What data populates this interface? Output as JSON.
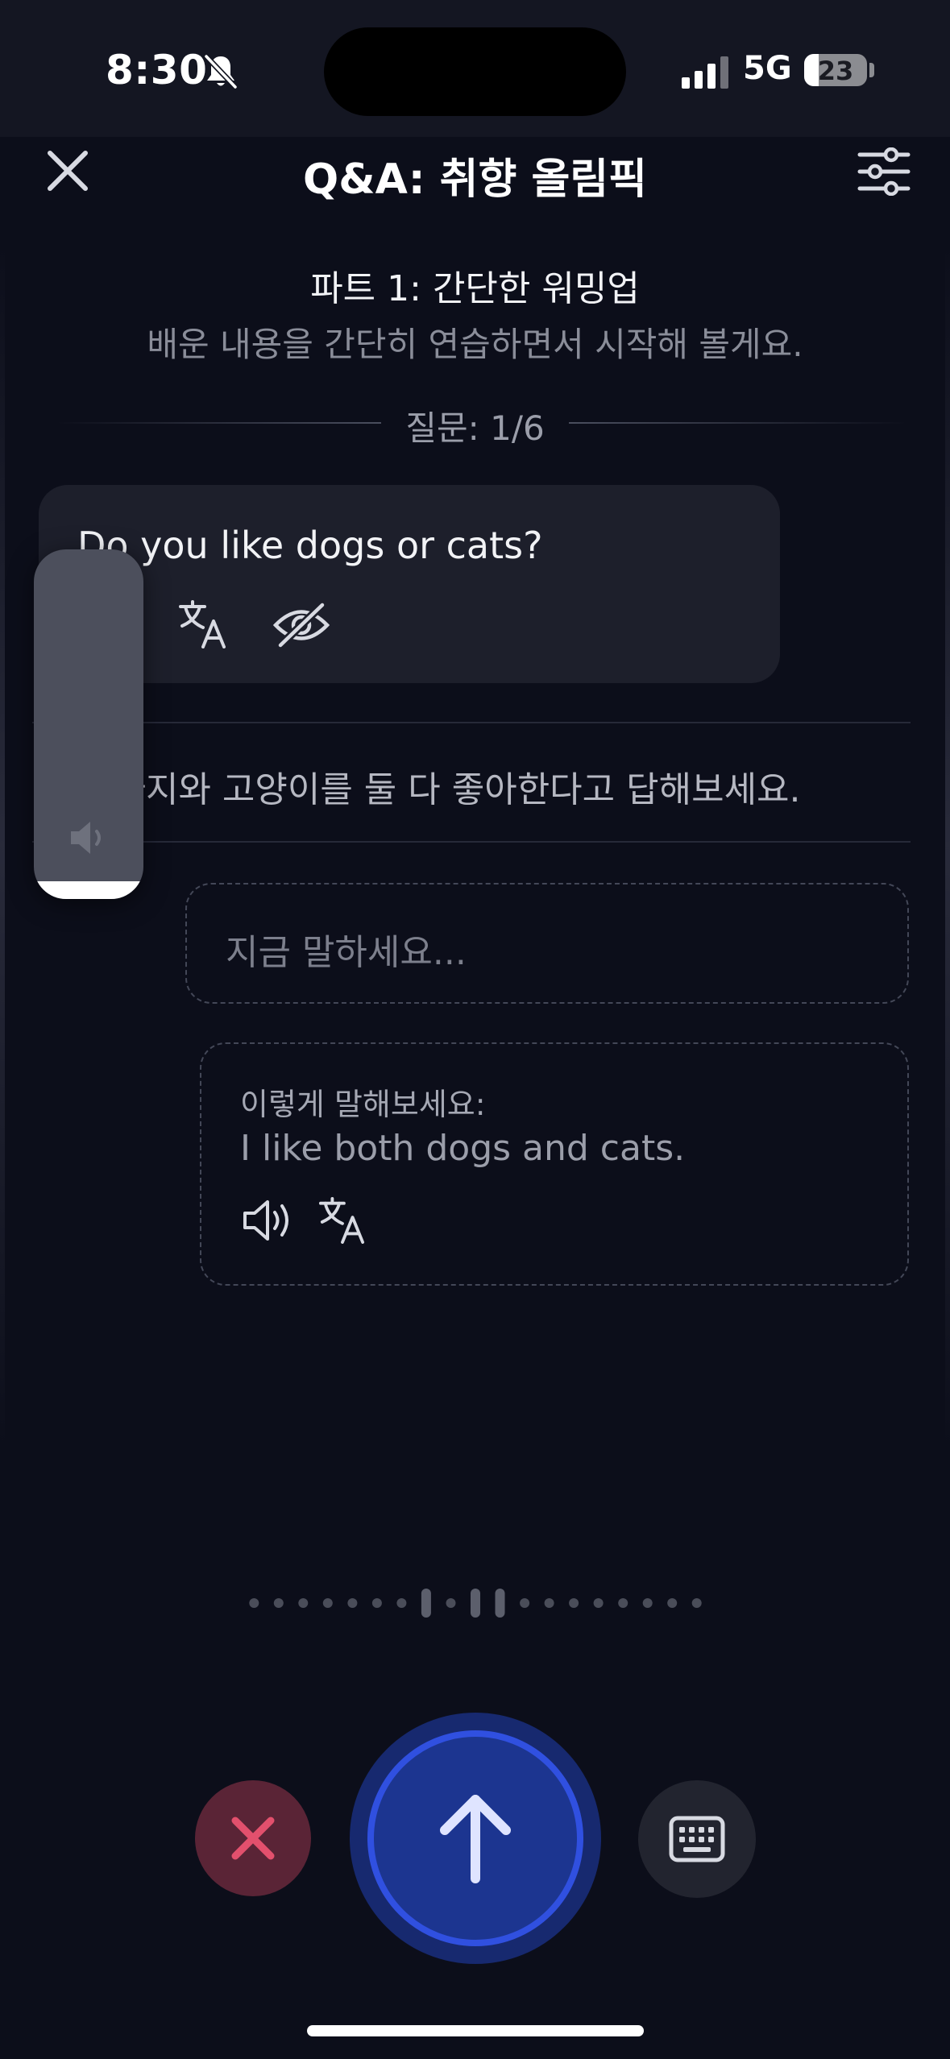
{
  "status_bar": {
    "time": "8:30",
    "network": "5G",
    "battery_level": "23",
    "battery_fraction": 0.23,
    "silent_icon": "bell-slash-icon",
    "signal_icon": "cellular-signal-icon"
  },
  "header": {
    "title": "Q&A: 취향 올림픽",
    "close_icon": "close-icon",
    "settings_icon": "sliders-icon"
  },
  "part": {
    "title": "파트 1: 간단한 워밍업",
    "subtitle": "배운 내용을 간단히 연습하면서 시작해 볼게요.",
    "counter": "질문: 1/6"
  },
  "question": {
    "text": "Do you like dogs or cats?",
    "icons": [
      "speaker-icon",
      "translate-icon",
      "eye-slash-icon"
    ]
  },
  "hint": {
    "text": "강아지와 고양이를 둘 다 좋아한다고 답해보세요."
  },
  "answer_input": {
    "placeholder": "지금 말하세요..."
  },
  "sample_answer": {
    "label": "이렇게 말해보세요:",
    "text": "I like both dogs and cats.",
    "icons": [
      "speaker-icon",
      "translate-icon"
    ]
  },
  "volume_overlay": {
    "level": 0.05,
    "icon": "speaker-icon"
  },
  "waveform": {
    "bars": [
      0.1,
      0.1,
      0.1,
      0.1,
      0.1,
      0.1,
      0.1,
      0.3,
      0.1,
      0.3,
      0.3,
      0.1,
      0.1,
      0.1,
      0.1,
      0.1,
      0.1,
      0.1,
      0.1
    ]
  },
  "controls": {
    "cancel_icon": "close-icon",
    "send_icon": "arrow-up-icon",
    "keyboard_icon": "keyboard-icon"
  },
  "colors": {
    "background": "#0c0e1a",
    "accent": "#3050e0",
    "cancel": "#e2506d",
    "bubble": "#1d1f2b"
  }
}
